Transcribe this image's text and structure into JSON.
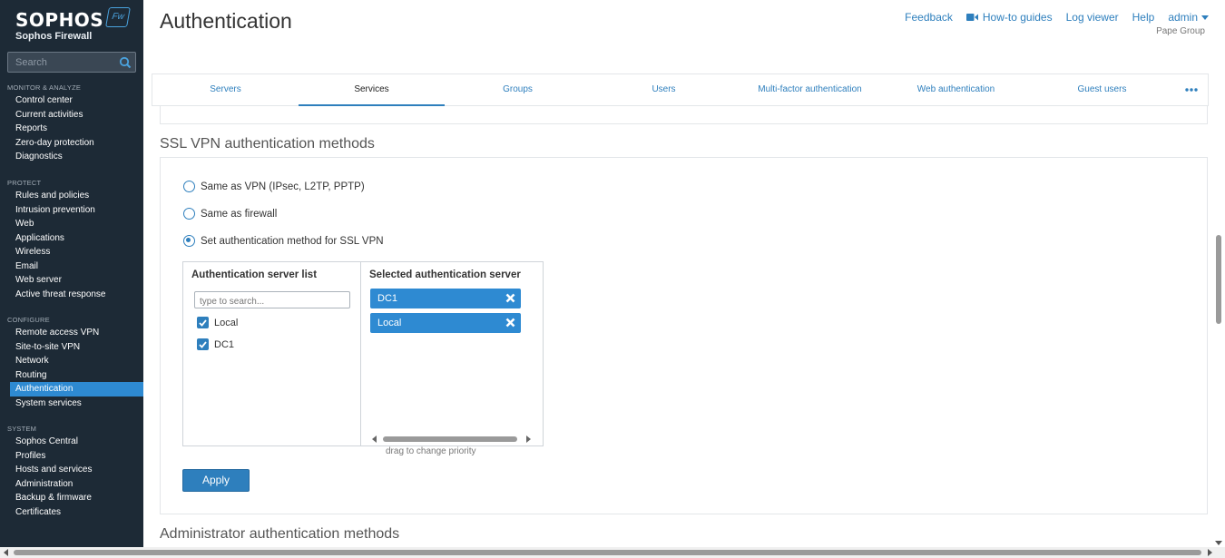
{
  "brand": {
    "name": "SOPHOS",
    "product": "Sophos Firewall",
    "badge": "Fw"
  },
  "search": {
    "placeholder": "Search"
  },
  "nav": [
    {
      "heading": "MONITOR & ANALYZE",
      "items": [
        "Control center",
        "Current activities",
        "Reports",
        "Zero-day protection",
        "Diagnostics"
      ]
    },
    {
      "heading": "PROTECT",
      "items": [
        "Rules and policies",
        "Intrusion prevention",
        "Web",
        "Applications",
        "Wireless",
        "Email",
        "Web server",
        "Active threat response"
      ]
    },
    {
      "heading": "CONFIGURE",
      "items": [
        "Remote access VPN",
        "Site-to-site VPN",
        "Network",
        "Routing",
        "Authentication",
        "System services"
      ]
    },
    {
      "heading": "SYSTEM",
      "items": [
        "Sophos Central",
        "Profiles",
        "Hosts and services",
        "Administration",
        "Backup & firmware",
        "Certificates"
      ]
    }
  ],
  "active_nav": "Authentication",
  "header": {
    "title": "Authentication",
    "links": {
      "feedback": "Feedback",
      "guides": "How-to guides",
      "log_viewer": "Log viewer",
      "help": "Help",
      "admin": "admin"
    },
    "org": "Pape Group"
  },
  "tabs": [
    "Servers",
    "Services",
    "Groups",
    "Users",
    "Multi-factor authentication",
    "Web authentication",
    "Guest users"
  ],
  "active_tab": "Services",
  "section": {
    "title": "SSL VPN authentication methods",
    "options": [
      "Same as VPN (IPsec, L2TP, PPTP)",
      "Same as firewall",
      "Set authentication method for SSL VPN"
    ],
    "selected_option": 2,
    "server_list_header": "Authentication server list",
    "selected_header": "Selected authentication server",
    "filter_placeholder": "type to search...",
    "available": [
      "Local",
      "DC1"
    ],
    "selected": [
      "DC1",
      "Local"
    ],
    "drag_hint": "drag to change priority",
    "apply": "Apply"
  },
  "next_section_title": "Administrator authentication methods",
  "colors": {
    "sidebar": "#1d2a36",
    "accent": "#2e7fbd",
    "active_nav": "#2e8ad2"
  }
}
